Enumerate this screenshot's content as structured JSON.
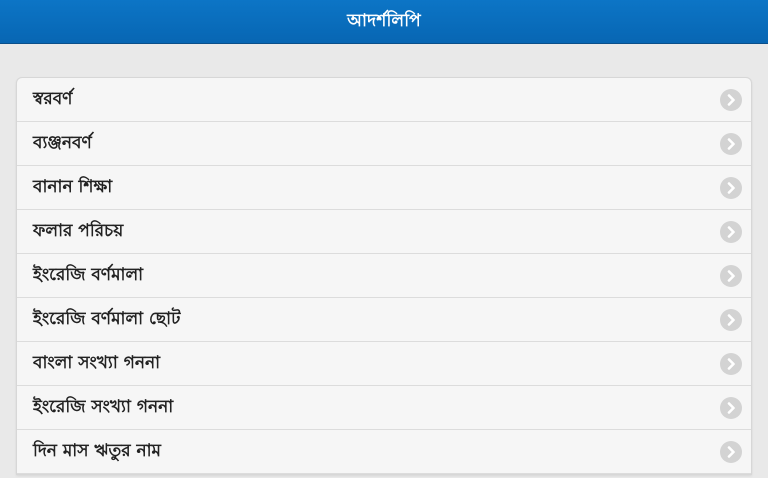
{
  "header": {
    "title": "আদর্শলিপি"
  },
  "menu": {
    "chevron_icon": "chevron-right-icon",
    "items": [
      {
        "label": "স্বরবর্ণ"
      },
      {
        "label": "ব্যঞ্জনবর্ণ"
      },
      {
        "label": "বানান শিক্ষা"
      },
      {
        "label": "ফলার পরিচয়"
      },
      {
        "label": "ইংরেজি বর্ণমালা"
      },
      {
        "label": "ইংরেজি বর্ণমালা ছোট"
      },
      {
        "label": "বাংলা সংখ্যা গননা"
      },
      {
        "label": "ইংরেজি সংখ্যা গননা"
      },
      {
        "label": "দিন মাস ঋতুর নাম"
      }
    ]
  },
  "colors": {
    "header_bg": "#0c75c6",
    "list_bg": "#f6f6f6",
    "page_bg": "#e9e9e9"
  }
}
